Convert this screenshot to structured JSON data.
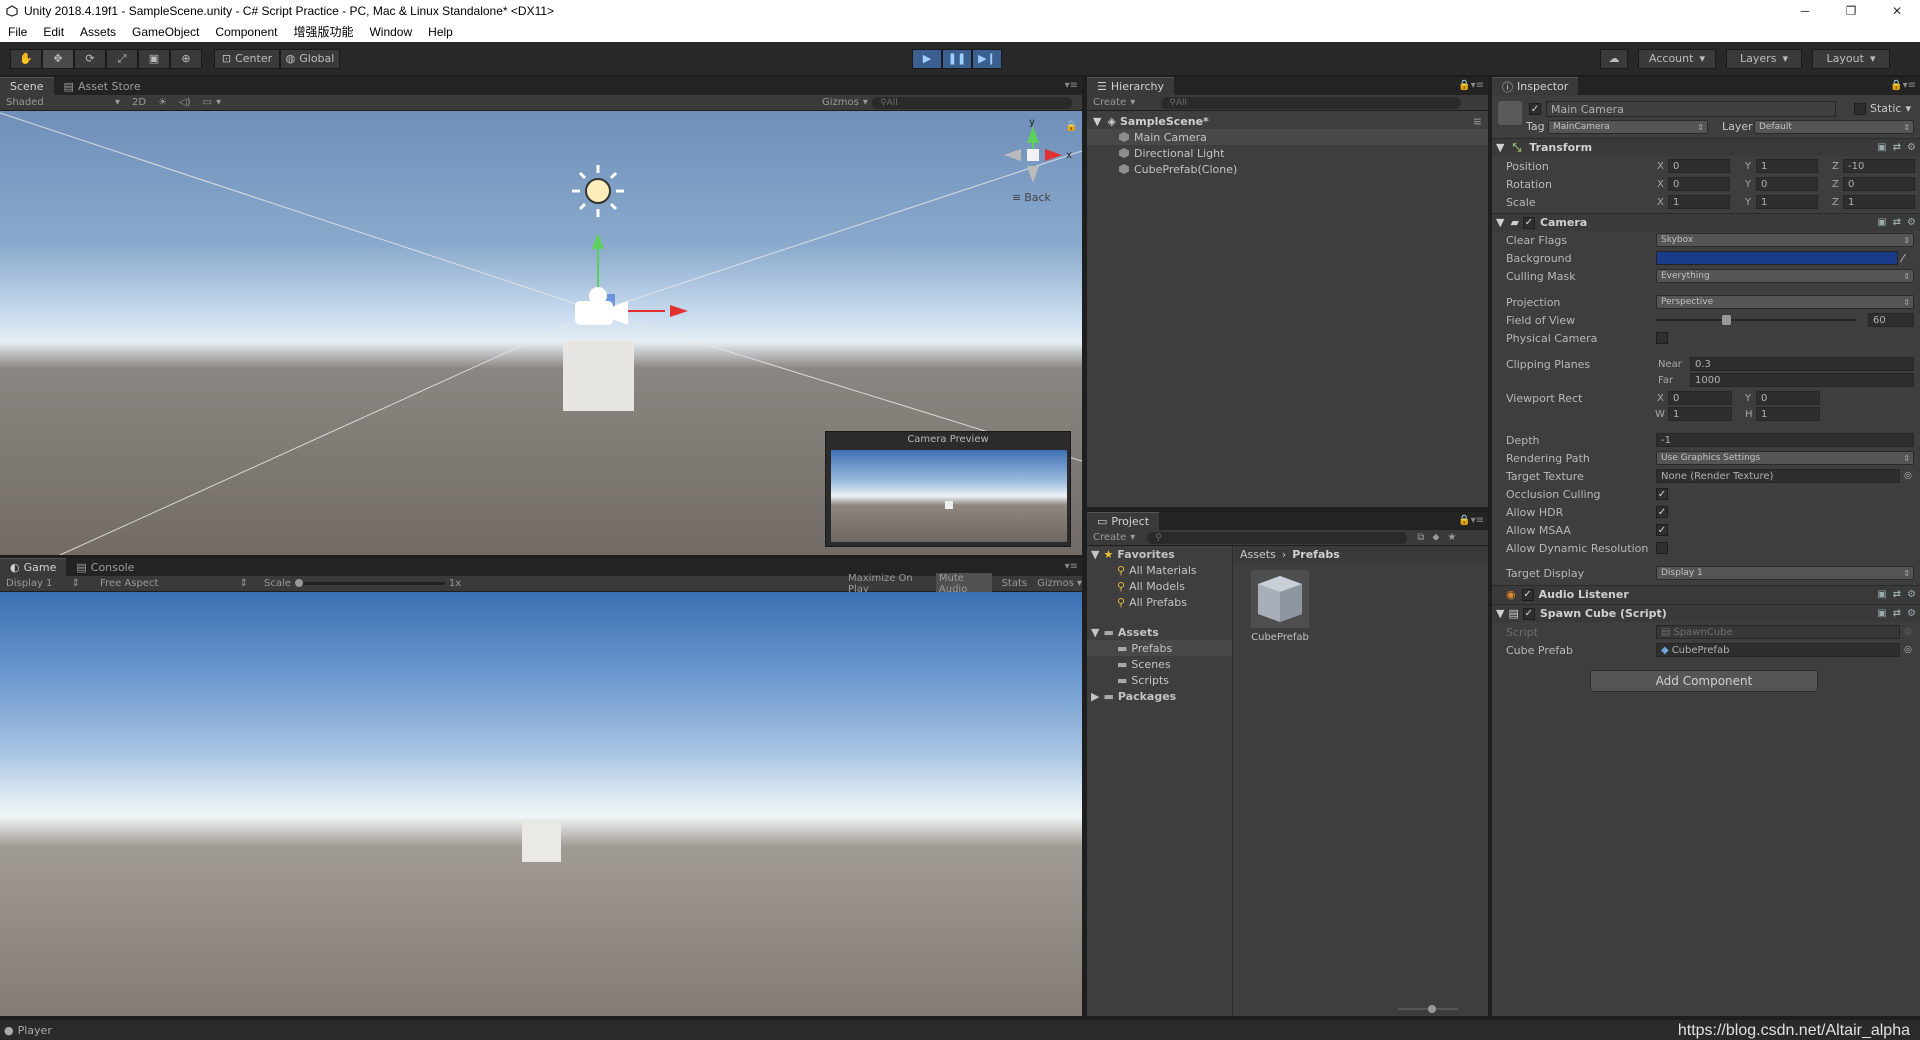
{
  "window": {
    "title": "Unity 2018.4.19f1 - SampleScene.unity - C# Script Practice - PC, Mac & Linux Standalone* <DX11>"
  },
  "menu": [
    "File",
    "Edit",
    "Assets",
    "GameObject",
    "Component",
    "增强版功能",
    "Window",
    "Help"
  ],
  "toolbar": {
    "center_label": "Center",
    "global_label": "Global",
    "account_label": "Account",
    "layers_label": "Layers",
    "layout_label": "Layout"
  },
  "scene": {
    "tab_scene": "Scene",
    "tab_asset_store": "Asset Store",
    "shading_mode": "Shaded",
    "mode_2d": "2D",
    "gizmos_label": "Gizmos",
    "search_placeholder": "All",
    "gizmo_back_label": "Back",
    "gizmo_y": "y",
    "gizmo_x": "x",
    "camera_preview_title": "Camera Preview"
  },
  "game": {
    "tab_game": "Game",
    "tab_console": "Console",
    "display": "Display 1",
    "aspect": "Free Aspect",
    "scale_label": "Scale",
    "scale_value": "1x",
    "maximize_on_play": "Maximize On Play",
    "mute_audio": "Mute Audio",
    "stats": "Stats",
    "gizmos_label": "Gizmos"
  },
  "hierarchy": {
    "tab_label": "Hierarchy",
    "create_label": "Create",
    "search_placeholder": "All",
    "scene_name": "SampleScene*",
    "items": [
      "Main Camera",
      "Directional Light",
      "CubePrefab(Clone)"
    ]
  },
  "project": {
    "tab_label": "Project",
    "create_label": "Create",
    "favorites_label": "Favorites",
    "favorites": [
      "All Materials",
      "All Models",
      "All Prefabs"
    ],
    "assets_label": "Assets",
    "asset_folders": [
      "Prefabs",
      "Scenes",
      "Scripts"
    ],
    "packages_label": "Packages",
    "breadcrumb_root": "Assets",
    "breadcrumb_current": "Prefabs",
    "asset_name": "CubePrefab"
  },
  "inspector": {
    "tab_label": "Inspector",
    "object_name": "Main Camera",
    "static_label": "Static",
    "tag_label": "Tag",
    "tag_value": "MainCamera",
    "layer_label": "Layer",
    "layer_value": "Default",
    "transform": {
      "header": "Transform",
      "position_label": "Position",
      "rotation_label": "Rotation",
      "scale_label": "Scale",
      "position": {
        "x": "0",
        "y": "1",
        "z": "-10"
      },
      "rotation": {
        "x": "0",
        "y": "0",
        "z": "0"
      },
      "scale": {
        "x": "1",
        "y": "1",
        "z": "1"
      }
    },
    "camera": {
      "header": "Camera",
      "clear_flags_label": "Clear Flags",
      "clear_flags_value": "Skybox",
      "background_label": "Background",
      "background_color": "#1a3a8a",
      "culling_mask_label": "Culling Mask",
      "culling_mask_value": "Everything",
      "projection_label": "Projection",
      "projection_value": "Perspective",
      "fov_label": "Field of View",
      "fov_value": "60",
      "physical_camera_label": "Physical Camera",
      "clipping_planes_label": "Clipping Planes",
      "near_label": "Near",
      "near_value": "0.3",
      "far_label": "Far",
      "far_value": "1000",
      "viewport_rect_label": "Viewport Rect",
      "vp_x": "0",
      "vp_y": "0",
      "vp_w": "1",
      "vp_h": "1",
      "depth_label": "Depth",
      "depth_value": "-1",
      "rendering_path_label": "Rendering Path",
      "rendering_path_value": "Use Graphics Settings",
      "target_texture_label": "Target Texture",
      "target_texture_value": "None (Render Texture)",
      "occlusion_culling_label": "Occlusion Culling",
      "allow_hdr_label": "Allow HDR",
      "allow_msaa_label": "Allow MSAA",
      "allow_dynamic_res_label": "Allow Dynamic Resolution",
      "target_display_label": "Target Display",
      "target_display_value": "Display 1"
    },
    "audio_listener_header": "Audio Listener",
    "spawn_cube": {
      "header": "Spawn Cube (Script)",
      "script_label": "Script",
      "script_value": "SpawnCube",
      "cube_prefab_label": "Cube Prefab",
      "cube_prefab_value": "CubePrefab"
    },
    "add_component_label": "Add Component"
  },
  "status": {
    "player_label": "Player",
    "watermark": "https://blog.csdn.net/Altair_alpha"
  }
}
